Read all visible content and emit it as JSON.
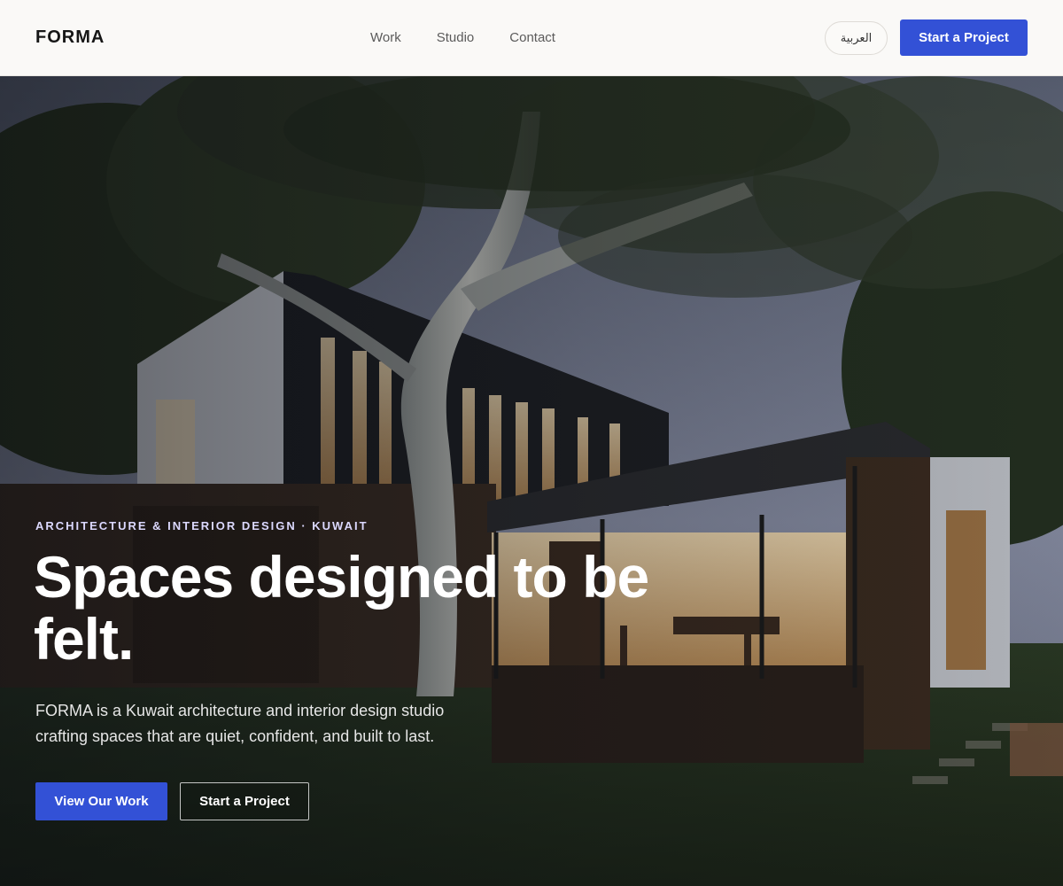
{
  "brand": {
    "name": "FORMA"
  },
  "nav": {
    "items": [
      {
        "label": "Work"
      },
      {
        "label": "Studio"
      },
      {
        "label": "Contact"
      }
    ],
    "language_toggle": "العربية",
    "cta": "Start a Project"
  },
  "hero": {
    "eyebrow": "ARCHITECTURE & INTERIOR DESIGN · KUWAIT",
    "headline": "Spaces designed to be felt.",
    "description": "FORMA is a Kuwait architecture and interior design studio crafting spaces that are quiet, confident, and built to last.",
    "primary_button": "View Our Work",
    "secondary_button": "Start a Project",
    "image": "modern-house-at-dusk-photo"
  },
  "colors": {
    "accent": "#3351d6",
    "header_bg": "#faf9f7",
    "text_dark": "#161616"
  }
}
